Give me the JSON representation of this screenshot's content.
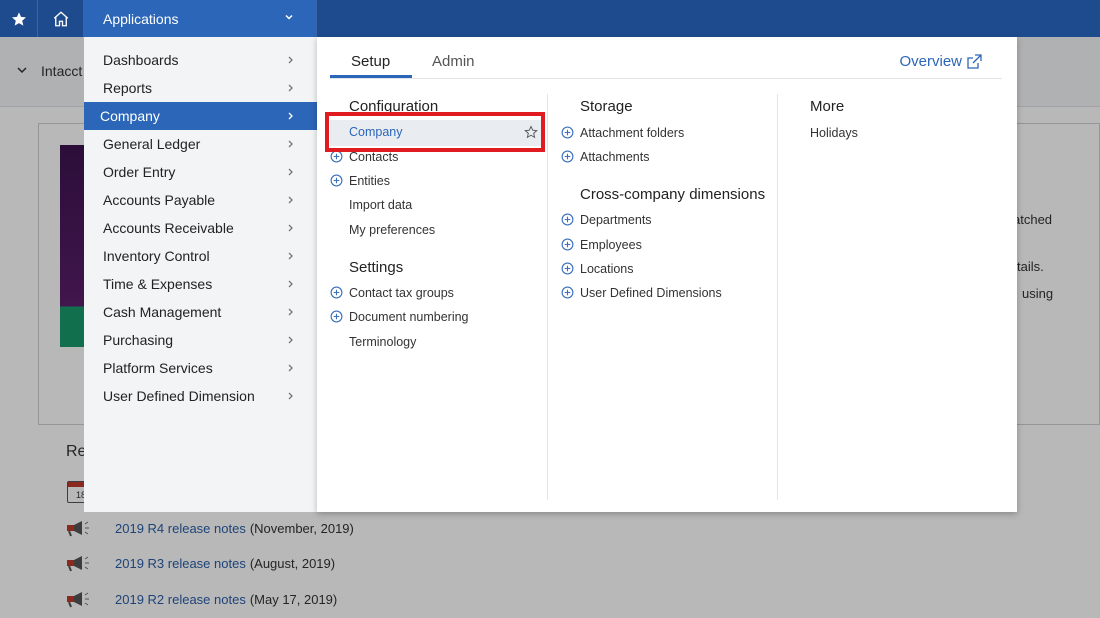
{
  "topbar": {
    "star_icon": "star-icon",
    "home_icon": "home-icon",
    "apps_label": "Applications"
  },
  "background": {
    "header_title": "Intacct",
    "text_fragments": [
      "atched",
      "tails.",
      "using"
    ],
    "releases_heading": "Re",
    "calendar_day": "18",
    "releases": [
      {
        "link": "2019 R4 release notes",
        "date": "(November, 2019)"
      },
      {
        "link": "2019 R3 release notes",
        "date": "(August, 2019)"
      },
      {
        "link": "2019 R2 release notes",
        "date": "(May 17, 2019)"
      }
    ]
  },
  "menu": {
    "items": [
      {
        "label": "Dashboards"
      },
      {
        "label": "Reports"
      },
      {
        "label": "Company",
        "active": true
      },
      {
        "label": "General Ledger"
      },
      {
        "label": "Order Entry"
      },
      {
        "label": "Accounts Payable"
      },
      {
        "label": "Accounts Receivable"
      },
      {
        "label": "Inventory Control"
      },
      {
        "label": "Time & Expenses"
      },
      {
        "label": "Cash Management"
      },
      {
        "label": "Purchasing"
      },
      {
        "label": "Platform Services"
      },
      {
        "label": "User Defined Dimension"
      }
    ]
  },
  "flyout": {
    "tabs": [
      {
        "label": "Setup",
        "active": true
      },
      {
        "label": "Admin"
      }
    ],
    "overview_label": "Overview",
    "col1": {
      "configuration_heading": "Configuration",
      "highlighted": "Company",
      "config_items": [
        {
          "label": "Contacts",
          "plus": true
        },
        {
          "label": "Entities",
          "plus": true
        },
        {
          "label": "Import data",
          "plus": false
        },
        {
          "label": "My preferences",
          "plus": false
        }
      ],
      "settings_heading": "Settings",
      "settings_items": [
        {
          "label": "Contact tax groups",
          "plus": true
        },
        {
          "label": "Document numbering",
          "plus": true
        },
        {
          "label": "Terminology",
          "plus": false
        }
      ]
    },
    "col2": {
      "storage_heading": "Storage",
      "storage_items": [
        {
          "label": "Attachment folders",
          "plus": true
        },
        {
          "label": "Attachments",
          "plus": true
        }
      ],
      "dimensions_heading": "Cross-company dimensions",
      "dimension_items": [
        {
          "label": "Departments",
          "plus": true
        },
        {
          "label": "Employees",
          "plus": true
        },
        {
          "label": "Locations",
          "plus": true
        },
        {
          "label": "User Defined Dimensions",
          "plus": true
        }
      ]
    },
    "col3": {
      "more_heading": "More",
      "more_items": [
        {
          "label": "Holidays"
        }
      ]
    }
  },
  "colors": {
    "topbar": "#1e4b8e",
    "accent": "#2c66b8",
    "highlight_box": "#e11b22"
  }
}
